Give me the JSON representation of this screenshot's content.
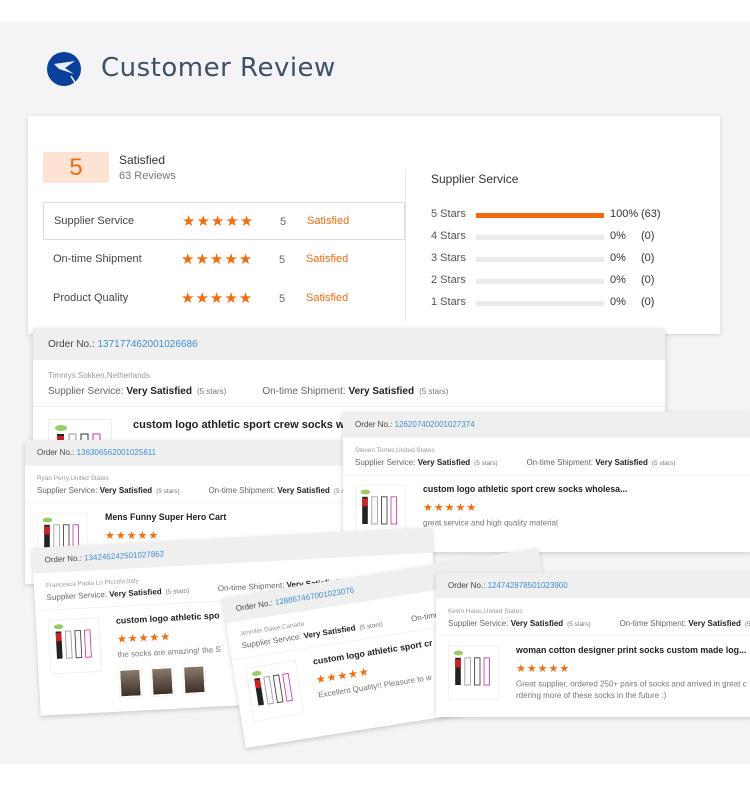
{
  "header": {
    "title": "Customer Review",
    "logo": "bird-logo"
  },
  "summary": {
    "score": "5",
    "label": "Satisfied",
    "reviews": "63 Reviews",
    "rows": [
      {
        "label": "Supplier Service",
        "stars": 5,
        "value": "5",
        "result": "Satisfied"
      },
      {
        "label": "On-time Shipment",
        "stars": 5,
        "value": "5",
        "result": "Satisfied"
      },
      {
        "label": "Product Quality",
        "stars": 5,
        "value": "5",
        "result": "Satisfied"
      }
    ],
    "breakdown_title": "Supplier Service",
    "breakdown": [
      {
        "label": "5 Stars",
        "percent": 100,
        "pct_text": "100%",
        "count": "(63)"
      },
      {
        "label": "4 Stars",
        "percent": 0,
        "pct_text": "0%",
        "count": "(0)"
      },
      {
        "label": "3 Stars",
        "percent": 0,
        "pct_text": "0%",
        "count": "(0)"
      },
      {
        "label": "2 Stars",
        "percent": 0,
        "pct_text": "0%",
        "count": "(0)"
      },
      {
        "label": "1 Stars",
        "percent": 0,
        "pct_text": "0%",
        "count": "(0)"
      }
    ]
  },
  "labels": {
    "order": "Order No.:",
    "supplier": "Supplier Service:",
    "shipment": "On-time Shipment:",
    "very": "Very Satisfied",
    "five": "(5 stars)"
  },
  "reviews": [
    {
      "order": "137177462001026686",
      "buyer": "Timmys Sokken,Netherlands",
      "product": "custom logo athletic sport crew socks whol",
      "stars": 5,
      "comment": "",
      "photos": 0
    },
    {
      "order": "136306562001025611",
      "buyer": "Ryan Perry,United States",
      "product": "Mens Funny Super Hero Cart",
      "stars": 5,
      "comment": "",
      "photos": 0
    },
    {
      "order": "126207402001027374",
      "buyer": "Steven Torres,United States",
      "product": "custom logo athletic sport crew socks wholesa...",
      "stars": 5,
      "comment": "great service and high quality material",
      "photos": 0
    },
    {
      "order": "134245242501027862",
      "buyer": "Francesca Paola Lo Piccolo,Italy",
      "product": "custom logo athletic spo",
      "stars": 5,
      "comment": "the socks are amazing! the S",
      "photos": 3
    },
    {
      "order": "128867467001023076",
      "buyer": "Jennifer Dawe,Canada",
      "product": "custom logo athletic sport cr",
      "stars": 5,
      "comment": "Excellent Quality!! Pleasure to w",
      "photos": 0
    },
    {
      "order": "124742878501023900",
      "buyer": "Kevin Halas,United States",
      "product": "woman cotton designer print socks custom made log...",
      "stars": 5,
      "comment": "Great supplier, ordered 250+ pairs of socks and arrived in great c\nrdering more of these socks in the future :)",
      "photos": 0
    }
  ],
  "colors": {
    "accent": "#f26c0d",
    "link": "#3c8ed6",
    "score_bg": "#fde3d3"
  }
}
